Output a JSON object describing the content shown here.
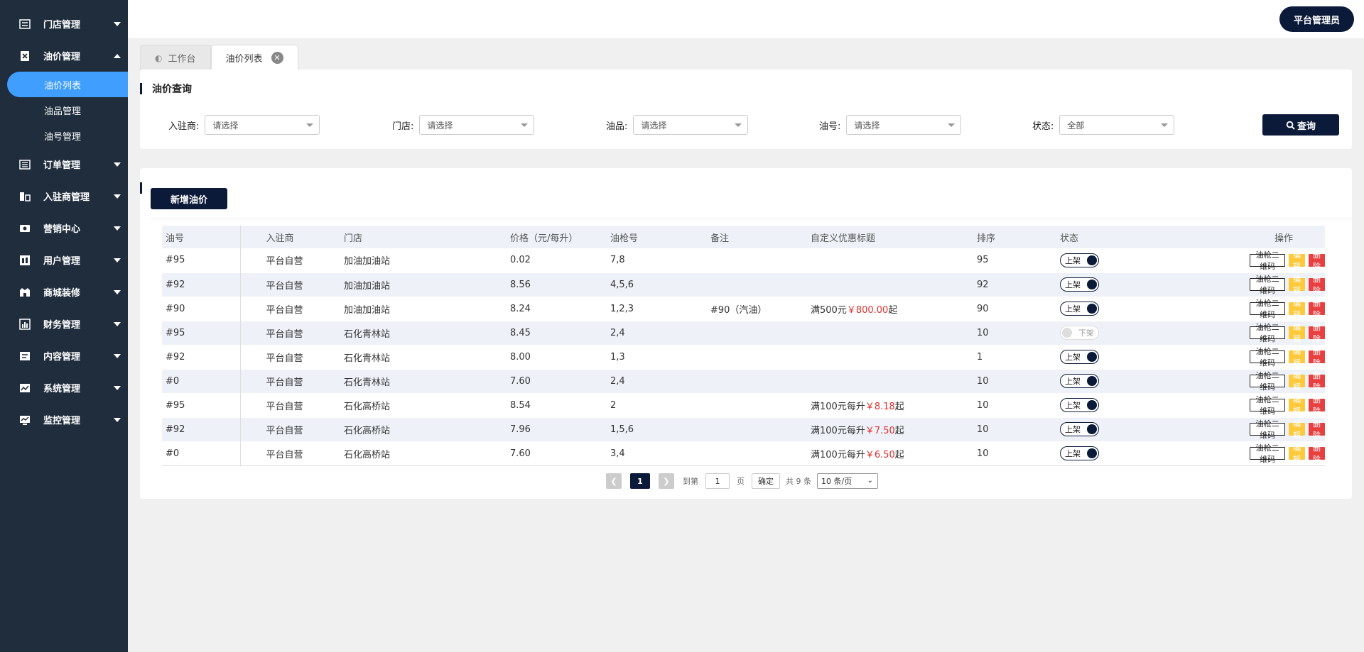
{
  "sidebar": {
    "items": [
      {
        "label": "门店管理",
        "icon": "store-icon",
        "expanded": false
      },
      {
        "label": "油价管理",
        "icon": "fuel-icon",
        "expanded": true,
        "children": [
          {
            "label": "油价列表",
            "active": true
          },
          {
            "label": "油品管理",
            "active": false
          },
          {
            "label": "油号管理",
            "active": false
          }
        ]
      },
      {
        "label": "订单管理",
        "icon": "order-icon",
        "expanded": false
      },
      {
        "label": "入驻商管理",
        "icon": "merchant-icon",
        "expanded": false
      },
      {
        "label": "营销中心",
        "icon": "marketing-icon",
        "expanded": false
      },
      {
        "label": "用户管理",
        "icon": "user-icon",
        "expanded": false
      },
      {
        "label": "商城装修",
        "icon": "mall-icon",
        "expanded": false
      },
      {
        "label": "财务管理",
        "icon": "finance-icon",
        "expanded": false
      },
      {
        "label": "内容管理",
        "icon": "content-icon",
        "expanded": false
      },
      {
        "label": "系统管理",
        "icon": "system-icon",
        "expanded": false
      },
      {
        "label": "监控管理",
        "icon": "monitor-icon",
        "expanded": false
      }
    ]
  },
  "header": {
    "admin_label": "平台管理员"
  },
  "tabs": [
    {
      "label": "工作台",
      "icon": "dashboard-icon",
      "active": false
    },
    {
      "label": "油价列表",
      "active": true,
      "closable": true
    }
  ],
  "search": {
    "title": "油价查询",
    "filters": [
      {
        "label": "入驻商:",
        "value": "请选择"
      },
      {
        "label": "门店:",
        "value": "请选择"
      },
      {
        "label": "油品:",
        "value": "请选择"
      },
      {
        "label": "油号:",
        "value": "请选择"
      },
      {
        "label": "状态:",
        "value": "全部"
      }
    ],
    "query_label": "查询"
  },
  "list": {
    "add_label": "新增油价",
    "columns": [
      "油号",
      "入驻商",
      "门店",
      "价格（元/每升）",
      "油枪号",
      "备注",
      "自定义优惠标题",
      "排序",
      "状态",
      "操作"
    ],
    "rows": [
      {
        "oil_no": "#95",
        "merchant": "平台自营",
        "store": "加油加油站",
        "price": "0.02",
        "guns": "7,8",
        "remark": "",
        "promo_prefix": "",
        "promo_amount": "",
        "promo_suffix": "",
        "sort": "95",
        "status": "上架",
        "on": true
      },
      {
        "oil_no": "#92",
        "merchant": "平台自营",
        "store": "加油加油站",
        "price": "8.56",
        "guns": "4,5,6",
        "remark": "",
        "promo_prefix": "",
        "promo_amount": "",
        "promo_suffix": "",
        "sort": "92",
        "status": "上架",
        "on": true
      },
      {
        "oil_no": "#90",
        "merchant": "平台自营",
        "store": "加油加油站",
        "price": "8.24",
        "guns": "1,2,3",
        "remark": "#90（汽油）",
        "promo_prefix": "满500元",
        "promo_amount": "￥800.00",
        "promo_suffix": "起",
        "sort": "90",
        "status": "上架",
        "on": true
      },
      {
        "oil_no": "#95",
        "merchant": "平台自营",
        "store": "石化青林站",
        "price": "8.45",
        "guns": "2,4",
        "remark": "",
        "promo_prefix": "",
        "promo_amount": "",
        "promo_suffix": "",
        "sort": "10",
        "status": "下架",
        "on": false
      },
      {
        "oil_no": "#92",
        "merchant": "平台自营",
        "store": "石化青林站",
        "price": "8.00",
        "guns": "1,3",
        "remark": "",
        "promo_prefix": "",
        "promo_amount": "",
        "promo_suffix": "",
        "sort": "1",
        "status": "上架",
        "on": true
      },
      {
        "oil_no": "#0",
        "merchant": "平台自营",
        "store": "石化青林站",
        "price": "7.60",
        "guns": "2,4",
        "remark": "",
        "promo_prefix": "",
        "promo_amount": "",
        "promo_suffix": "",
        "sort": "10",
        "status": "上架",
        "on": true
      },
      {
        "oil_no": "#95",
        "merchant": "平台自营",
        "store": "石化高桥站",
        "price": "8.54",
        "guns": "2",
        "remark": "",
        "promo_prefix": "满100元每升",
        "promo_amount": "￥8.18",
        "promo_suffix": "起",
        "sort": "10",
        "status": "上架",
        "on": true
      },
      {
        "oil_no": "#92",
        "merchant": "平台自营",
        "store": "石化高桥站",
        "price": "7.96",
        "guns": "1,5,6",
        "remark": "",
        "promo_prefix": "满100元每升",
        "promo_amount": "￥7.50",
        "promo_suffix": "起",
        "sort": "10",
        "status": "上架",
        "on": true
      },
      {
        "oil_no": "#0",
        "merchant": "平台自营",
        "store": "石化高桥站",
        "price": "7.60",
        "guns": "3,4",
        "remark": "",
        "promo_prefix": "满100元每升",
        "promo_amount": "￥6.50",
        "promo_suffix": "起",
        "sort": "10",
        "status": "上架",
        "on": true
      }
    ],
    "ops": {
      "qr": "油枪二维码",
      "edit": "编辑",
      "del": "删除"
    }
  },
  "pager": {
    "current": "1",
    "goto_prefix": "到第",
    "goto_value": "1",
    "goto_suffix": "页",
    "confirm": "确定",
    "total": "共 9 条",
    "size": "10 条/页"
  },
  "colors": {
    "primary": "#0c1a3a",
    "sidebar_bg": "#1f2d3d",
    "active_blue": "#409eff",
    "edit": "#ffc93c",
    "delete": "#e84040",
    "promo_red": "#e03030"
  }
}
